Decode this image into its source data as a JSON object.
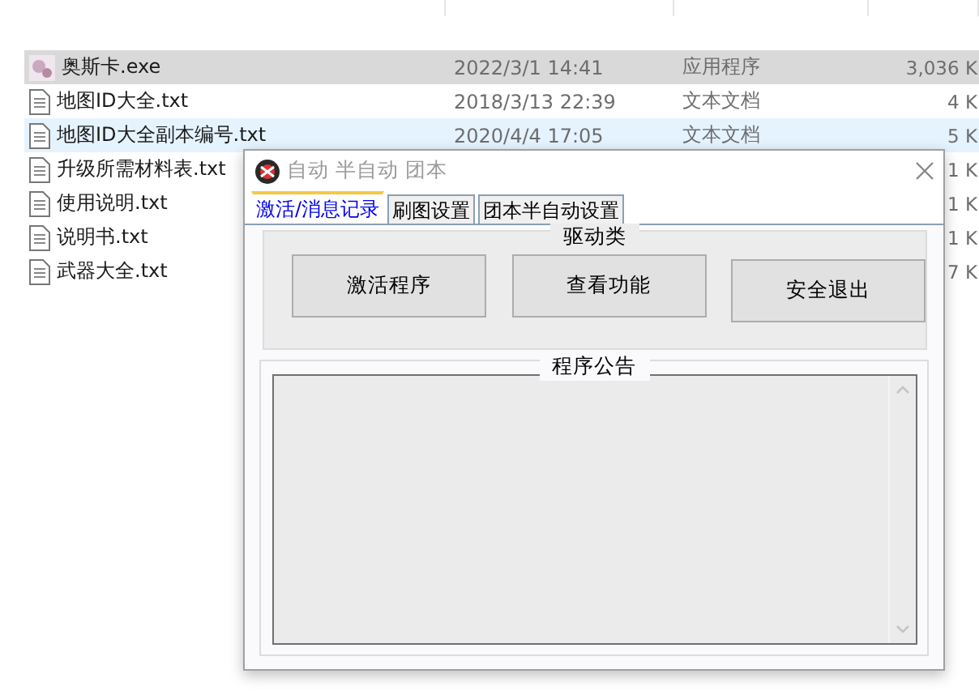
{
  "file_list": {
    "rows": [
      {
        "kind": "app",
        "name": "奥斯卡.exe",
        "date": "2022/3/1 14:41",
        "type": "应用程序",
        "size": "3,036 K",
        "selected": true,
        "highlighted": false
      },
      {
        "kind": "text",
        "name": "地图ID大全.txt",
        "date": "2018/3/13 22:39",
        "type": "文本文档",
        "size": "4 K",
        "selected": false,
        "highlighted": false
      },
      {
        "kind": "text",
        "name": "地图ID大全副本编号.txt",
        "date": "2020/4/4 17:05",
        "type": "文本文档",
        "size": "5 K",
        "selected": false,
        "highlighted": true
      },
      {
        "kind": "text",
        "name": "升级所需材料表.txt",
        "size": "1 K",
        "selected": false,
        "highlighted": false
      },
      {
        "kind": "text",
        "name": "使用说明.txt",
        "size": "1 K",
        "selected": false,
        "highlighted": false
      },
      {
        "kind": "text",
        "name": "说明书.txt",
        "size": "1 K",
        "selected": false,
        "highlighted": false
      },
      {
        "kind": "text",
        "name": "武器大全.txt",
        "size": "7 K",
        "selected": false,
        "highlighted": false
      }
    ]
  },
  "dialog": {
    "title": "自动 半自动 团本",
    "tabs": [
      {
        "label": "激活/消息记录",
        "selected": true
      },
      {
        "label": "刷图设置",
        "selected": false
      },
      {
        "label": "团本半自动设置",
        "selected": false
      }
    ],
    "driver_group": {
      "title": "驱动类",
      "buttons": [
        "激活程序",
        "查看功能",
        "安全退出"
      ]
    },
    "notice_group": {
      "title": "程序公告"
    }
  }
}
